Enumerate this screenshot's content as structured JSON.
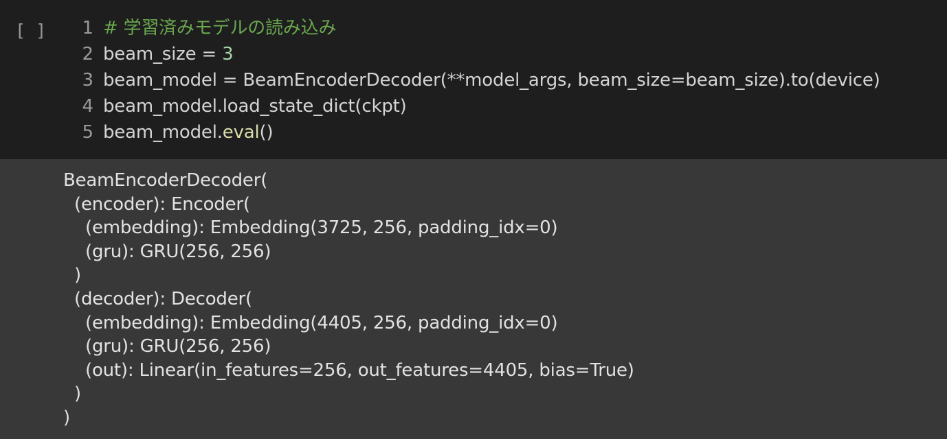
{
  "cell": {
    "run_indicator": "[ ]",
    "code_lines": [
      {
        "number": "1",
        "parts": [
          {
            "text": "# 学習済みモデルの読み込み",
            "kind": "comment"
          }
        ]
      },
      {
        "number": "2",
        "parts": [
          {
            "text": "beam_size = ",
            "kind": "plain"
          },
          {
            "text": "3",
            "kind": "number"
          }
        ]
      },
      {
        "number": "3",
        "parts": [
          {
            "text": "beam_model = BeamEncoderDecoder(**model_args, beam_size=beam_size).to(device)",
            "kind": "plain"
          }
        ]
      },
      {
        "number": "4",
        "parts": [
          {
            "text": "beam_model.load_state_dict(ckpt)",
            "kind": "plain"
          }
        ]
      },
      {
        "number": "5",
        "parts": [
          {
            "text": "beam_model.",
            "kind": "plain"
          },
          {
            "text": "eval",
            "kind": "func"
          },
          {
            "text": "()",
            "kind": "plain"
          }
        ]
      }
    ],
    "output_lines": [
      {
        "text": "BeamEncoderDecoder(",
        "indent": 0
      },
      {
        "text": "(encoder): Encoder(",
        "indent": 1
      },
      {
        "text": "(embedding): Embedding(3725, 256, padding_idx=0)",
        "indent": 2
      },
      {
        "text": "(gru): GRU(256, 256)",
        "indent": 2
      },
      {
        "text": ")",
        "indent": 1
      },
      {
        "text": "(decoder): Decoder(",
        "indent": 1
      },
      {
        "text": "(embedding): Embedding(4405, 256, padding_idx=0)",
        "indent": 2
      },
      {
        "text": "(gru): GRU(256, 256)",
        "indent": 2
      },
      {
        "text": "(out): Linear(in_features=256, out_features=4405, bias=True)",
        "indent": 2
      },
      {
        "text": ")",
        "indent": 1
      },
      {
        "text": ")",
        "indent": 0
      }
    ]
  },
  "colors": {
    "code_background": "#1e1e1e",
    "output_background": "#383838",
    "comment": "#6aa84f",
    "number": "#a5d6a7",
    "function": "#dcdcaa",
    "plain_code": "#d4d4d4",
    "output_text": "#e2e2e2",
    "line_number": "#9a9a9a"
  }
}
